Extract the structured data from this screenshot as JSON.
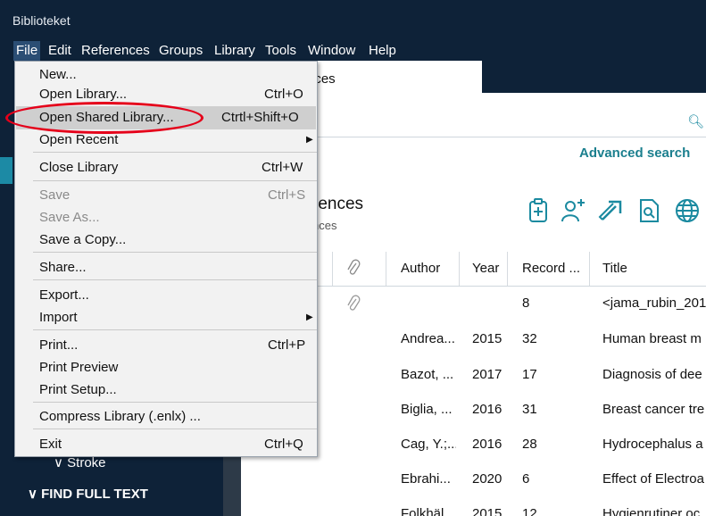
{
  "app": {
    "title": "Biblioteket"
  },
  "menubar": [
    "File",
    "Edit",
    "References",
    "Groups",
    "Library",
    "Tools",
    "Window",
    "Help"
  ],
  "file_menu": {
    "items": [
      {
        "label": "New...",
        "shortcut": ""
      },
      {
        "label": "Open Library...",
        "shortcut": "Ctrl+O"
      },
      {
        "label": "Open Shared Library...",
        "shortcut": "Ctrtl+Shift+O"
      },
      {
        "label": "Open Recent",
        "shortcut": ""
      },
      {
        "label": "Close Library",
        "shortcut": "Ctrl+W"
      },
      {
        "label": "Save",
        "shortcut": "Ctrl+S"
      },
      {
        "label": "Save As...",
        "shortcut": ""
      },
      {
        "label": "Save a Copy...",
        "shortcut": ""
      },
      {
        "label": "Share...",
        "shortcut": ""
      },
      {
        "label": "Export...",
        "shortcut": ""
      },
      {
        "label": "Import",
        "shortcut": ""
      },
      {
        "label": "Print...",
        "shortcut": "Ctrl+P"
      },
      {
        "label": "Print Preview",
        "shortcut": ""
      },
      {
        "label": "Print Setup...",
        "shortcut": ""
      },
      {
        "label": "Compress Library (.enlx) ...",
        "shortcut": ""
      },
      {
        "label": "Exit",
        "shortcut": "Ctrl+Q"
      }
    ]
  },
  "sidebar": {
    "stroke": "∨ Stroke",
    "find_full_text": "∨ FIND FULL TEXT"
  },
  "tab": {
    "label": "nces"
  },
  "toolbar": {
    "advanced_search": "Advanced search"
  },
  "header": {
    "title": "rences",
    "subtitle": "nces"
  },
  "table": {
    "headers": [
      "Author",
      "Year",
      "Record ...",
      "Title"
    ],
    "rows": [
      {
        "author": "",
        "year": "",
        "record": "8",
        "title": "<jama_rubin_201"
      },
      {
        "author": "Andrea...",
        "year": "2015",
        "record": "32",
        "title": "Human breast m"
      },
      {
        "author": "Bazot, ...",
        "year": "2017",
        "record": "17",
        "title": "Diagnosis of dee"
      },
      {
        "author": "Biglia, ...",
        "year": "2016",
        "record": "31",
        "title": "Breast cancer tre"
      },
      {
        "author": "Cag, Y.;...",
        "year": "2016",
        "record": "28",
        "title": "Hydrocephalus a"
      },
      {
        "author": "Ebrahi...",
        "year": "2020",
        "record": "6",
        "title": "Effect of Electroa"
      },
      {
        "author": "Folkhäl...",
        "year": "2015",
        "record": "12",
        "title": "Hygienrutiner oc"
      }
    ]
  },
  "colors": {
    "dark_bg": "#0e2238",
    "accent": "#1b7f8e",
    "annotation": "#e5001a"
  }
}
